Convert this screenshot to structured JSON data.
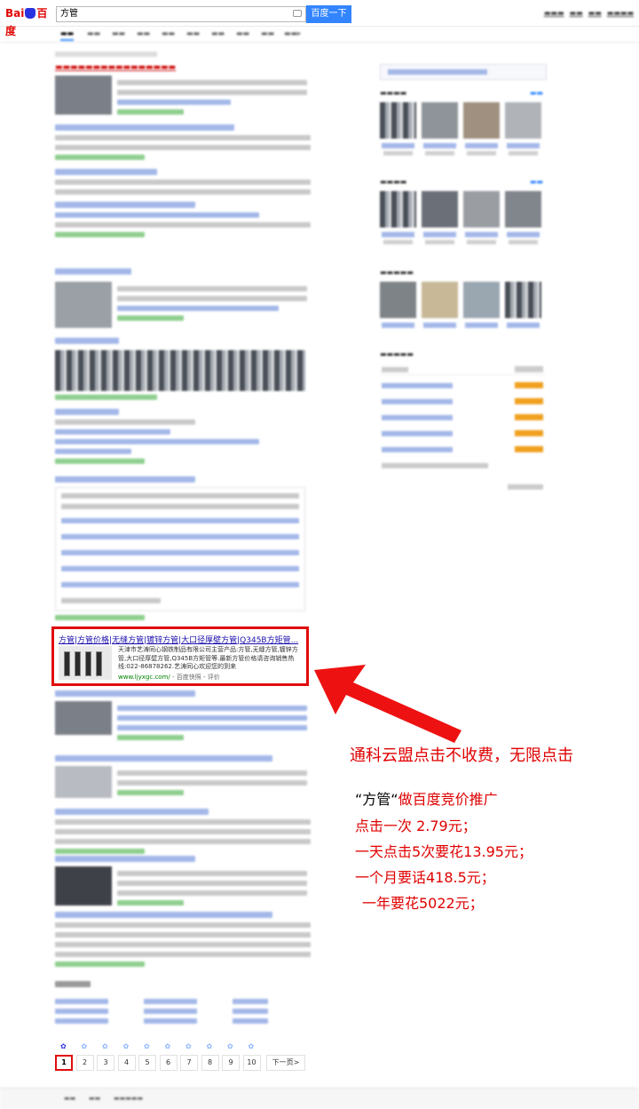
{
  "search": {
    "query": "方管",
    "button": "百度一下"
  },
  "ad": {
    "title": "方管|方管价格|无缝方管|镀锌方管|大口径厚壁方管|Q345B方矩管...",
    "description": "天津市艺涛同心钢铁制品有限公司主营产品:方管,无缝方管,镀锌方管,大口径厚壁方管,Q345B方矩管等.最新方管价格请咨询销售热线:022-86878262.艺涛同心欢迎您的到来",
    "url": "www.ljyxgc.com/",
    "url_suffix": "- 百度快照 - 评价"
  },
  "pagination": {
    "pages": [
      "1",
      "2",
      "3",
      "4",
      "5",
      "6",
      "7",
      "8",
      "9",
      "10"
    ],
    "next": "下一页>"
  },
  "annotations": {
    "headline": "通科云盟点击不收费，无限点击",
    "keyword": "“方管“",
    "line1": "做百度竞价推广",
    "line2": "点击一次   2.79元；",
    "line3": "一天点击5次要花13.95元；",
    "line4": "一个月要话418.5元；",
    "line5": "一年要花5022元；"
  },
  "colors": {
    "accent": "#3385ff",
    "highlight": "#e00c0c",
    "link": "#1a0dab",
    "url": "#008000"
  }
}
